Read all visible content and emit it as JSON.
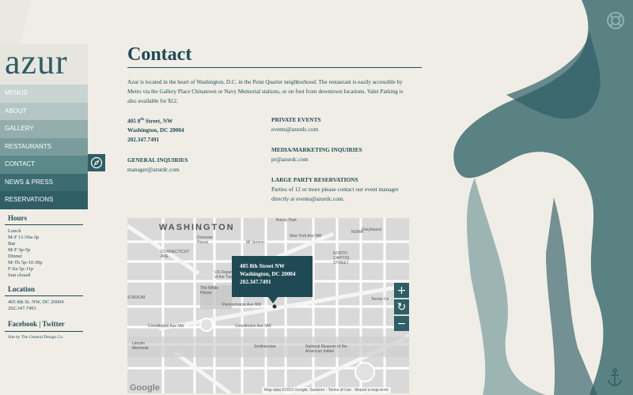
{
  "sidebar": {
    "logo": "azur",
    "nav": [
      {
        "label": "MENUS",
        "bg": "#c8d4d2"
      },
      {
        "label": "ABOUT",
        "bg": "#b3c5c4"
      },
      {
        "label": "GALLERY",
        "bg": "#94adad"
      },
      {
        "label": "RESTAURANTS",
        "bg": "#7a9c9c"
      },
      {
        "label": "CONTACT",
        "bg": "#5b8888"
      },
      {
        "label": "NEWS & PRESS",
        "bg": "#3c6c72"
      },
      {
        "label": "RESERVATIONS",
        "bg": "#2f5e66"
      }
    ],
    "hours": {
      "heading": "Hours",
      "lines": [
        "Lunch",
        "M-F 11:30a-3p",
        "Bar",
        "M-F 3p-5p",
        "Dinner",
        "M-Th 5p-10:30p",
        "F-Sa 5p-11p",
        "Sun closed"
      ]
    },
    "location": {
      "heading": "Location",
      "lines": [
        "405 8th St. NW, DC 20004",
        "202.347.7491"
      ]
    },
    "social": {
      "facebook": "Facebook",
      "sep": " | ",
      "twitter": "Twitter"
    },
    "credit": "Site by The General Design Co."
  },
  "main": {
    "title": "Contact",
    "intro": "Azur is located in the heart of Washington, D.C. in the Penn Quarter neighborhood. The restaurant is easily accessible by Metro via the Gallery Place Chinatown or Navy Memorial stations, or on foot from downtown locations. Valet Parking is also available for $12.",
    "address": {
      "street_num": "405 8",
      "street_sup": "th",
      "street_rest": " Street, NW",
      "city": "Washington, DC 20004",
      "phone": "202.347.7491"
    },
    "general": {
      "heading": "GENERAL INQUIRIES",
      "email": "manager@azurdc.com"
    },
    "private": {
      "heading": "PRIVATE EVENTS",
      "email": "events@azurdc.com"
    },
    "media": {
      "heading": "MEDIA/MARKETING INQUIRIES",
      "email": "pr@azurdc.com"
    },
    "party": {
      "heading": "LARGE PARTY RESERVATIONS",
      "text": "Parties of 12 or more please contact our event manager directly at events@azurdc.com."
    }
  },
  "map": {
    "city_label": "WASHINGTON",
    "tooltip": {
      "line1": "405 8th Street NW",
      "line2": "Washington, DC 20004",
      "line3": "202.347.7491"
    },
    "zoom_in": "+",
    "zoom_out": "−",
    "reset": "↻",
    "labels": {
      "bundy": "Bundy Park",
      "donovan": "Donovan House",
      "noma": "NOMA",
      "mvernon": "Mt Vernon",
      "nyave": "New York Ave NW",
      "northcap": "NORTH CAPITOL STREET",
      "greyhound": "Greyhound",
      "whitehouse": "The White House",
      "penn": "Pennsylvania Ave NW",
      "constitution1": "Constitution Ave NW",
      "constitution2": "Constitution Ave NW",
      "smithsonian": "Smithsonian",
      "lincoln": "Lincoln Memorial",
      "natmuseum": "National Museum of the American Indian",
      "tennis": "Tennis Co",
      "ustreasury": "US Department of the Treasury",
      "ct": "CONNECTICUT AVE",
      "stadium": "STADIUM"
    },
    "google": "Google",
    "footer": "Map data ©2013 Google, Sanborn · Terms of Use · Report a map error"
  },
  "icons": {
    "top_right": "lifebuoy-icon",
    "bottom_right": "anchor-icon",
    "contact": "compass-icon"
  }
}
